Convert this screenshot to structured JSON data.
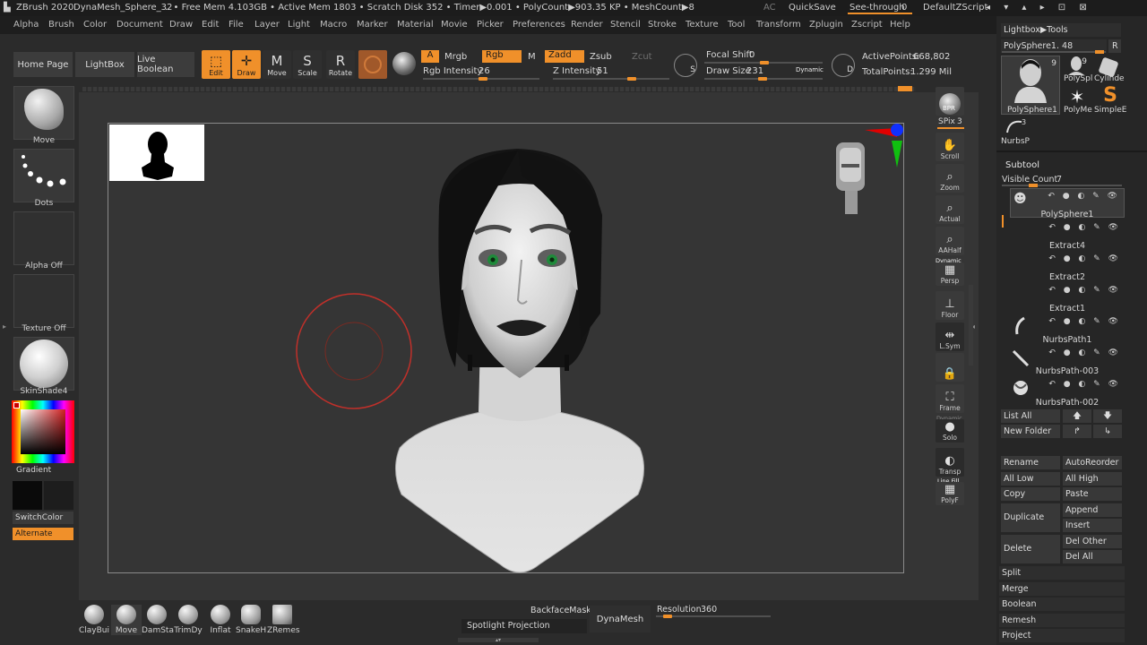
{
  "titlebar": {
    "app": "ZBrush 2020",
    "file": "DynaMesh_Sphere_32",
    "stats": ".. • Free Mem 4.103GB • Active Mem 1803 • Scratch Disk 352 • Timer▶0.001 • PolyCount▶903.35 KP • MeshCount▶8",
    "ac": "AC",
    "quicksave": "QuickSave",
    "seethrough": "See-through",
    "seethrough_value": "0",
    "zscript": "DefaultZScript"
  },
  "menu": [
    "Alpha",
    "Brush",
    "Color",
    "Document",
    "Draw",
    "Edit",
    "File",
    "Layer",
    "Light",
    "Macro",
    "Marker",
    "Material",
    "Movie",
    "Picker",
    "Preferences",
    "Render",
    "Stencil",
    "Stroke",
    "Texture",
    "Tool",
    "Transform",
    "Zplugin",
    "Zscript",
    "Help"
  ],
  "topshelf": {
    "home_page": "Home Page",
    "lightbox": "LightBox",
    "live_boolean": "Live Boolean",
    "edit": "Edit",
    "draw": "Draw",
    "move": "Move",
    "scale": "Scale",
    "rotate": "Rotate",
    "a": "A",
    "mrgb": "Mrgb",
    "rgb": "Rgb",
    "m": "M",
    "zadd": "Zadd",
    "zsub": "Zsub",
    "zcut": "Zcut",
    "rgb_intensity_label": "Rgb Intensity",
    "rgb_intensity": "26",
    "z_intensity_label": "Z Intensity",
    "z_intensity": "51",
    "focal_shift_label": "Focal Shift",
    "focal_shift": "0",
    "draw_size_label": "Draw Size",
    "draw_size": "231",
    "dynamic": "Dynamic",
    "active_points_label": "ActivePoints:",
    "active_points": "668,802",
    "total_points_label": "TotalPoints:",
    "total_points": "1.299 Mil"
  },
  "leftshelf": {
    "brush": "Move",
    "stroke": "Dots",
    "alpha": "Alpha Off",
    "texture": "Texture Off",
    "material": "SkinShade4",
    "gradient": "Gradient",
    "switch_color": "SwitchColor",
    "alternate": "Alternate"
  },
  "rightshelf": [
    "BPR",
    "SPix",
    "Scroll",
    "Zoom",
    "Actual",
    "AAHalf",
    "Persp",
    "Floor",
    "L.Sym",
    "Frame",
    "Solo",
    "Transp",
    "PolyF"
  ],
  "rightshelf_extra": {
    "spix_value": "3",
    "dynamic": "Dynamic",
    "line_fill": "Line Fill"
  },
  "tray": {
    "lightbox_tools": "Lightbox▶Tools",
    "current_tool": "PolySphere1.",
    "current_tool_value": "48",
    "r": "R",
    "tools": [
      {
        "name": "PolySphere1",
        "count": "9"
      },
      {
        "name": "PolySpl",
        "count": "9"
      },
      {
        "name": "Cylinde",
        "count": ""
      },
      {
        "name": "PolyMe",
        "count": ""
      },
      {
        "name": "SimpleE",
        "count": ""
      },
      {
        "name": "NurbsP",
        "count": "3"
      }
    ],
    "subtool_title": "Subtool",
    "visible_count_label": "Visible Count",
    "visible_count": "7",
    "subtools": [
      "PolySphere1",
      "Extract4",
      "Extract2",
      "Extract1",
      "NurbsPath1",
      "NurbsPath-003",
      "NurbsPath-002"
    ],
    "list_all": "List All",
    "new_folder": "New Folder",
    "rename": "Rename",
    "auto_reorder": "AutoReorder",
    "all_low": "All Low",
    "all_high": "All High",
    "copy": "Copy",
    "paste": "Paste",
    "duplicate": "Duplicate",
    "append": "Append",
    "insert": "Insert",
    "delete": "Delete",
    "del_other": "Del Other",
    "del_all": "Del All",
    "split": "Split",
    "merge": "Merge",
    "boolean": "Boolean",
    "remesh": "Remesh",
    "project": "Project"
  },
  "bottomshelf": {
    "brushes": [
      "ClayBui",
      "Move",
      "DamSta",
      "TrimDy",
      "Inflat",
      "SnakeH",
      "ZRemes"
    ],
    "backface_mask": "BackfaceMask",
    "spotlight_projection": "Spotlight Projection",
    "dynamesh": "DynaMesh",
    "resolution_label": "Resolution",
    "resolution": "360"
  },
  "colors": {
    "accent": "#f0902a",
    "bg": "#2b2b2b",
    "canvas": "#353535",
    "brush_ring": "#c0302a"
  }
}
